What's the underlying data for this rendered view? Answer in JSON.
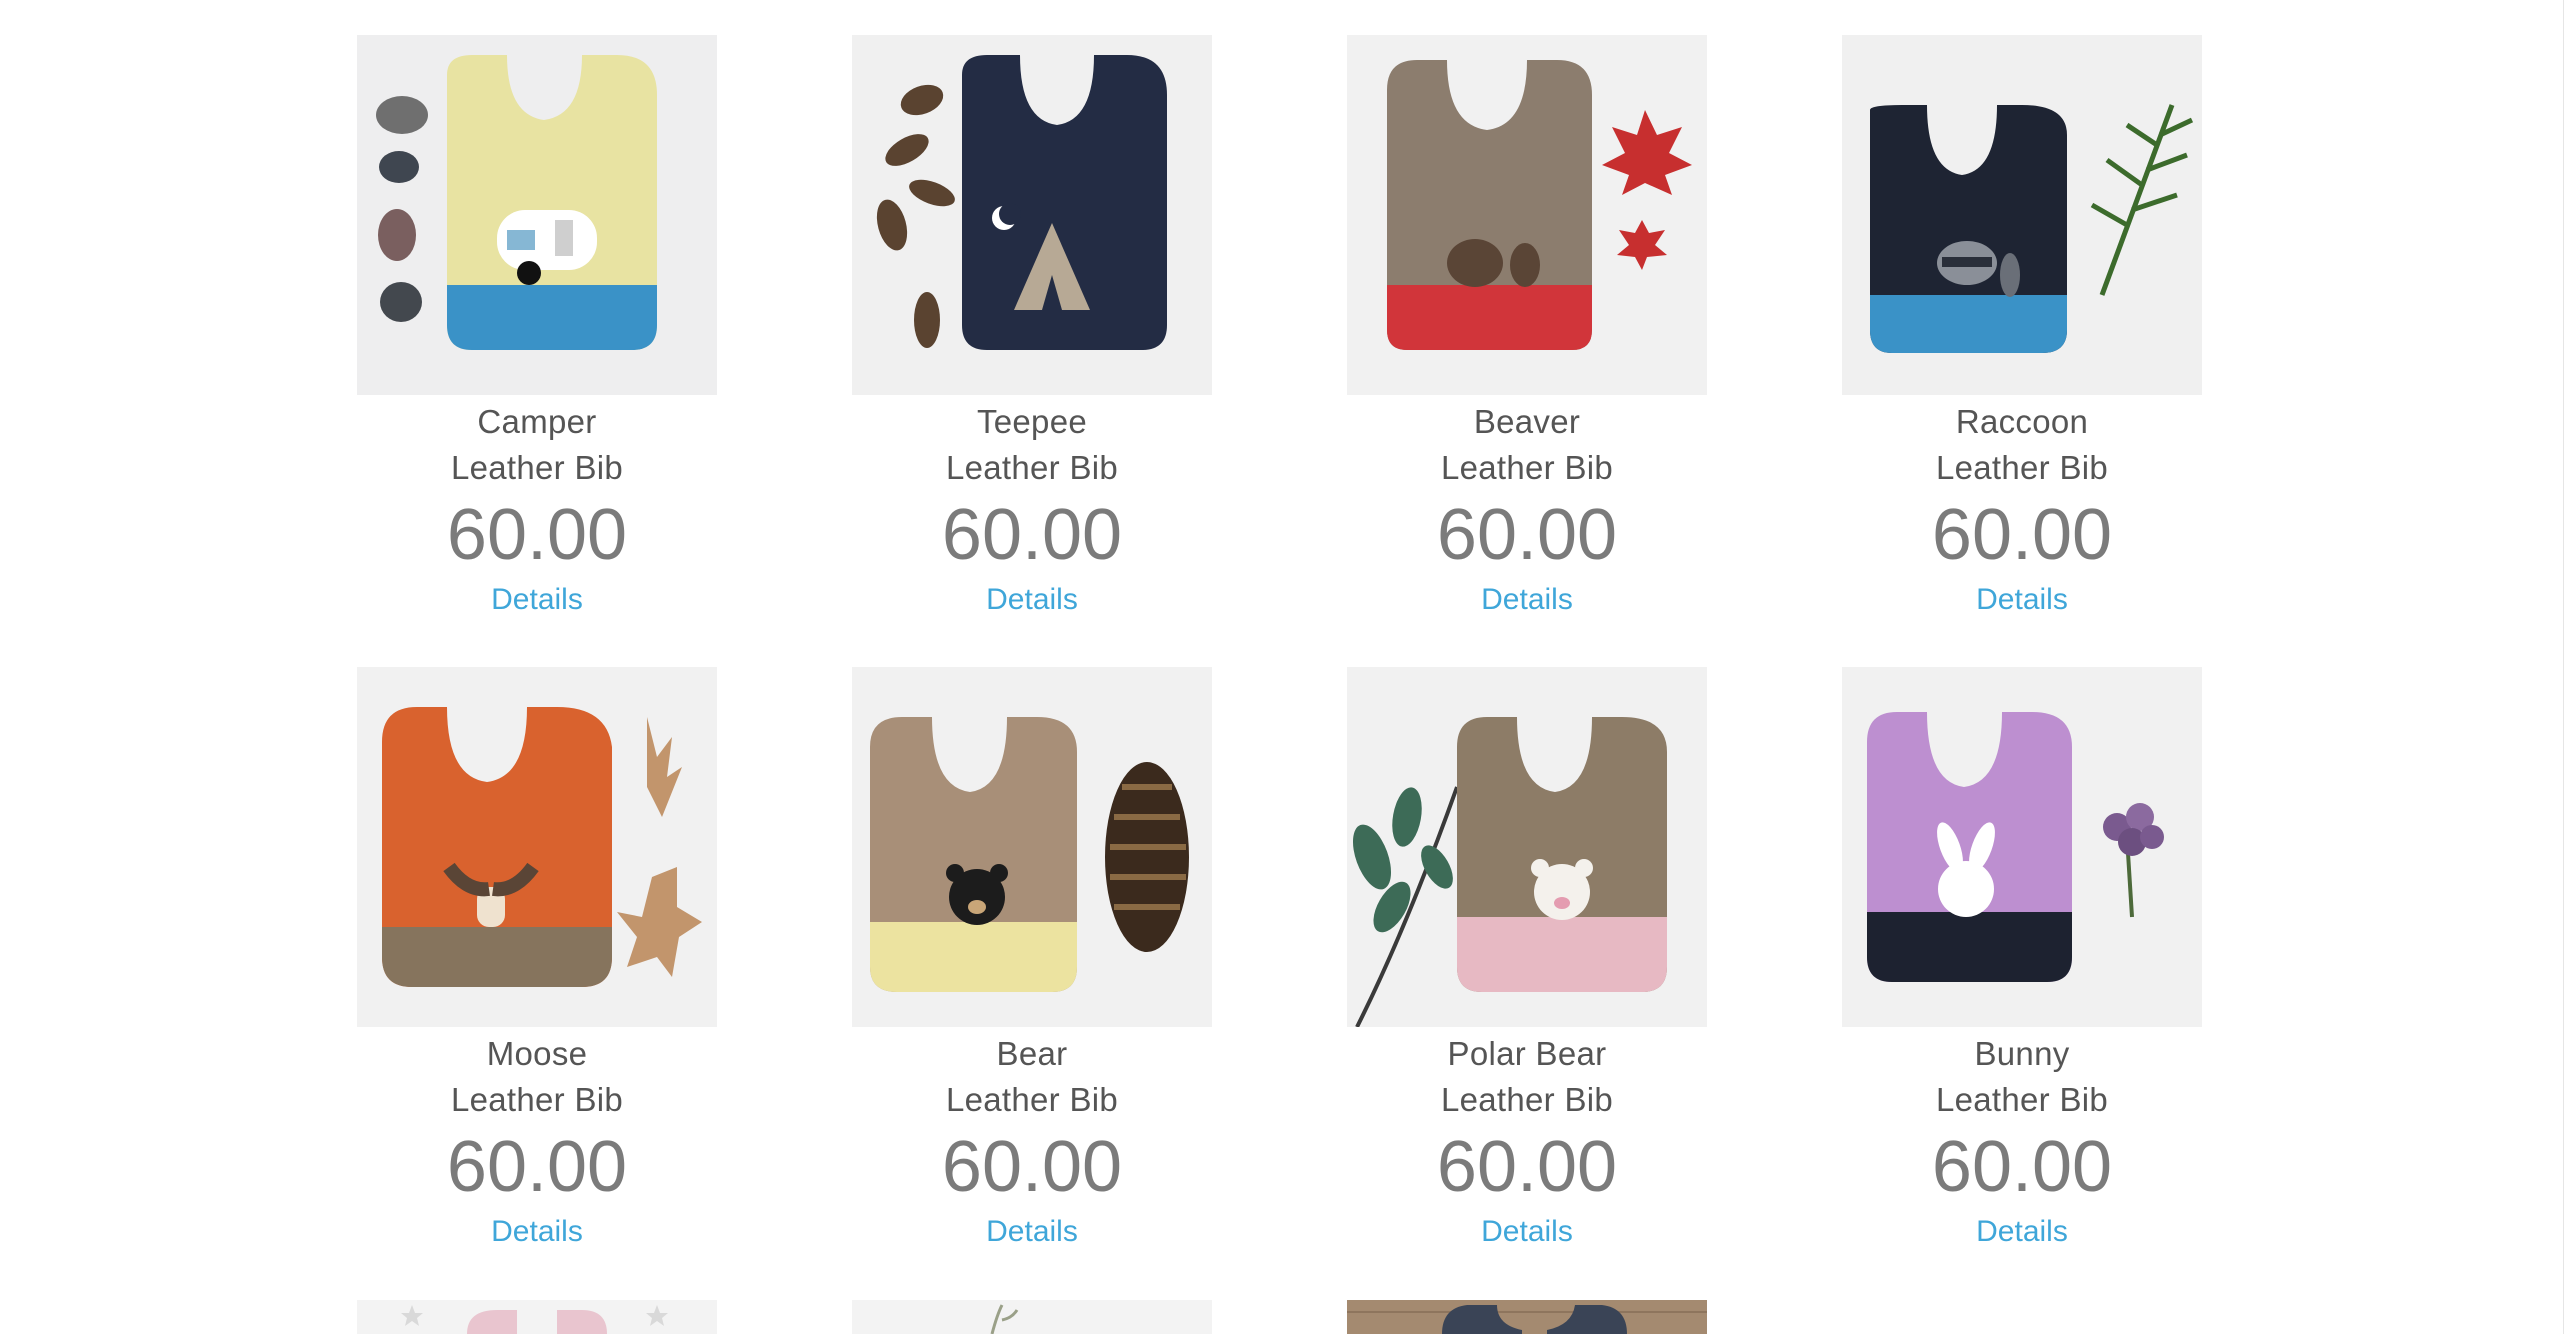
{
  "products": [
    {
      "title": "Camper",
      "subtitle": "Leather Bib",
      "price": "60.00",
      "link": "Details",
      "colors": {
        "top": "#e8e3a2",
        "bottom": "#3a92c7"
      },
      "deco": "pebbles-icon",
      "motif": "camper-trailer-icon"
    },
    {
      "title": "Teepee",
      "subtitle": "Leather Bib",
      "price": "60.00",
      "link": "Details",
      "colors": {
        "top": "#232c44",
        "bottom": "#232c44"
      },
      "deco": "pinecones-icon",
      "motif": "teepee-icon"
    },
    {
      "title": "Beaver",
      "subtitle": "Leather Bib",
      "price": "60.00",
      "link": "Details",
      "colors": {
        "top": "#8c7d6e",
        "bottom": "#d1353a"
      },
      "deco": "maple-leaf-icon",
      "motif": "beaver-icon"
    },
    {
      "title": "Raccoon",
      "subtitle": "Leather Bib",
      "price": "60.00",
      "link": "Details",
      "colors": {
        "top": "#1e2433",
        "bottom": "#3a92c7"
      },
      "deco": "pine-branch-icon",
      "motif": "raccoon-icon"
    },
    {
      "title": "Moose",
      "subtitle": "Leather Bib",
      "price": "60.00",
      "link": "Details",
      "colors": {
        "top": "#d9622e",
        "bottom": "#86745d"
      },
      "deco": "oak-leaf-icon",
      "motif": "moose-icon"
    },
    {
      "title": "Bear",
      "subtitle": "Leather Bib",
      "price": "60.00",
      "link": "Details",
      "colors": {
        "top": "#a88f78",
        "bottom": "#ece3a0"
      },
      "deco": "pinecone-icon",
      "motif": "bear-icon"
    },
    {
      "title": "Polar Bear",
      "subtitle": "Leather Bib",
      "price": "60.00",
      "link": "Details",
      "colors": {
        "top": "#8d7c67",
        "bottom": "#e7b9c3"
      },
      "deco": "eucalyptus-icon",
      "motif": "polar-bear-icon"
    },
    {
      "title": "Bunny",
      "subtitle": "Leather Bib",
      "price": "60.00",
      "link": "Details",
      "colors": {
        "top": "#bd8fd0",
        "bottom": "#1d2230"
      },
      "deco": "flower-icon",
      "motif": "bunny-icon"
    }
  ],
  "partial_row": [
    {
      "deco": "stars-icon",
      "bg": "#f3f3f3",
      "bib": "#e9c5cf"
    },
    {
      "deco": "leaf-icon",
      "bg": "#f3f3f3",
      "bib": "#f3f3f3"
    },
    {
      "deco": "wood-icon",
      "bg": "#a48a70",
      "bib": "#3a4456"
    }
  ]
}
